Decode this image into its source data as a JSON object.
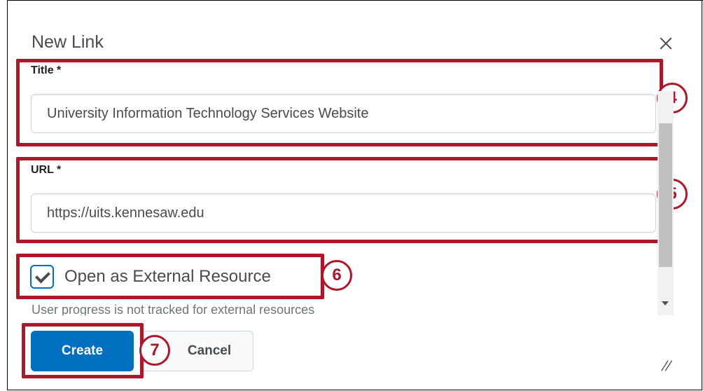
{
  "dialog": {
    "title": "New Link",
    "close_icon": "close-icon"
  },
  "form": {
    "title_label": "Title *",
    "title_value": "University Information Technology Services Website",
    "url_label": "URL *",
    "url_value": "https://uits.kennesaw.edu",
    "external_checkbox_label": "Open as External Resource",
    "external_checked": true,
    "helper_text": "User progress is not tracked for external resources"
  },
  "buttons": {
    "create_label": "Create",
    "cancel_label": "Cancel"
  },
  "callouts": [
    "4",
    "5",
    "6",
    "7"
  ],
  "colors": {
    "accent": "#006fbf",
    "highlight": "#b0162a"
  }
}
